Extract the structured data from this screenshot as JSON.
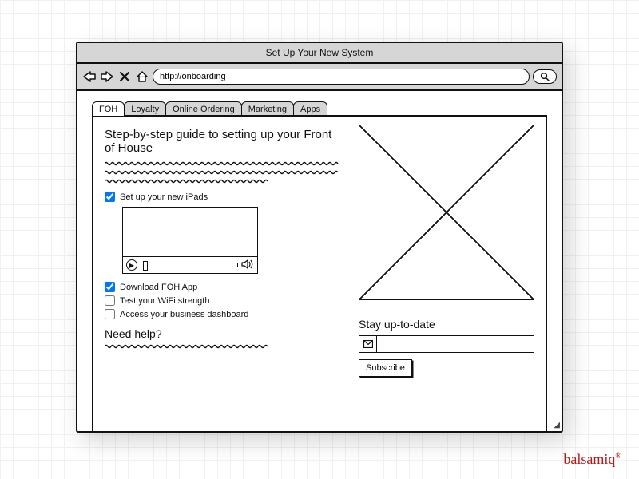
{
  "window": {
    "title": "Set Up Your New System"
  },
  "url": "http://onboarding",
  "tabs": [
    {
      "label": "FOH",
      "active": true
    },
    {
      "label": "Loyalty",
      "active": false
    },
    {
      "label": "Online Ordering",
      "active": false
    },
    {
      "label": "Marketing",
      "active": false
    },
    {
      "label": "Apps",
      "active": false
    }
  ],
  "main": {
    "heading": "Step-by-step guide to setting up your Front of House",
    "checklist": [
      {
        "label": "Set up your new iPads",
        "checked": true
      },
      {
        "label": "Download FOH App",
        "checked": true
      },
      {
        "label": "Test your WiFi strength",
        "checked": false
      },
      {
        "label": "Access your business dashboard",
        "checked": false
      }
    ],
    "help_heading": "Need help?"
  },
  "sidebar": {
    "stay_heading": "Stay up-to-date",
    "email_value": "",
    "subscribe_label": "Subscribe"
  },
  "brand": "balsamiq"
}
